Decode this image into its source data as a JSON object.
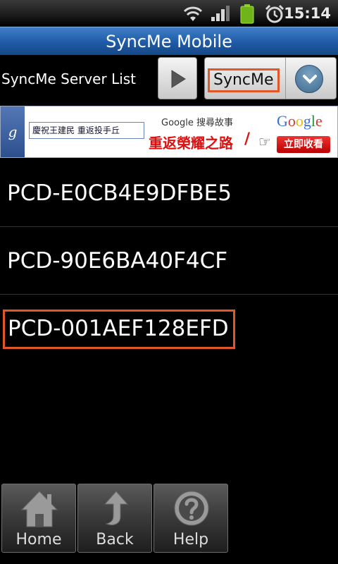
{
  "status_bar": {
    "time": "15:14",
    "icons": [
      "wifi-icon",
      "signal-icon",
      "battery-icon",
      "alarm-icon"
    ]
  },
  "title_bar": {
    "title": "SyncMe Mobile"
  },
  "server_row": {
    "label": "SyncMe Server List",
    "selected_value": "SyncMe"
  },
  "ad": {
    "search_text": "慶祝王建民 重返投手丘",
    "caption": "Google 搜尋故事",
    "headline": "重返榮耀之路",
    "logo": "Google",
    "cta": "立即收看"
  },
  "servers": [
    {
      "name": "PCD-E0CB4E9DFBE5"
    },
    {
      "name": "PCD-90E6BA40F4CF"
    },
    {
      "name": "PCD-001AEF128EFD"
    }
  ],
  "toolbar": {
    "home_label": "Home",
    "back_label": "Back",
    "help_label": "Help"
  },
  "colors": {
    "title_bar": "#1f5aa6",
    "highlight": "#e0572a",
    "background": "#000000"
  }
}
